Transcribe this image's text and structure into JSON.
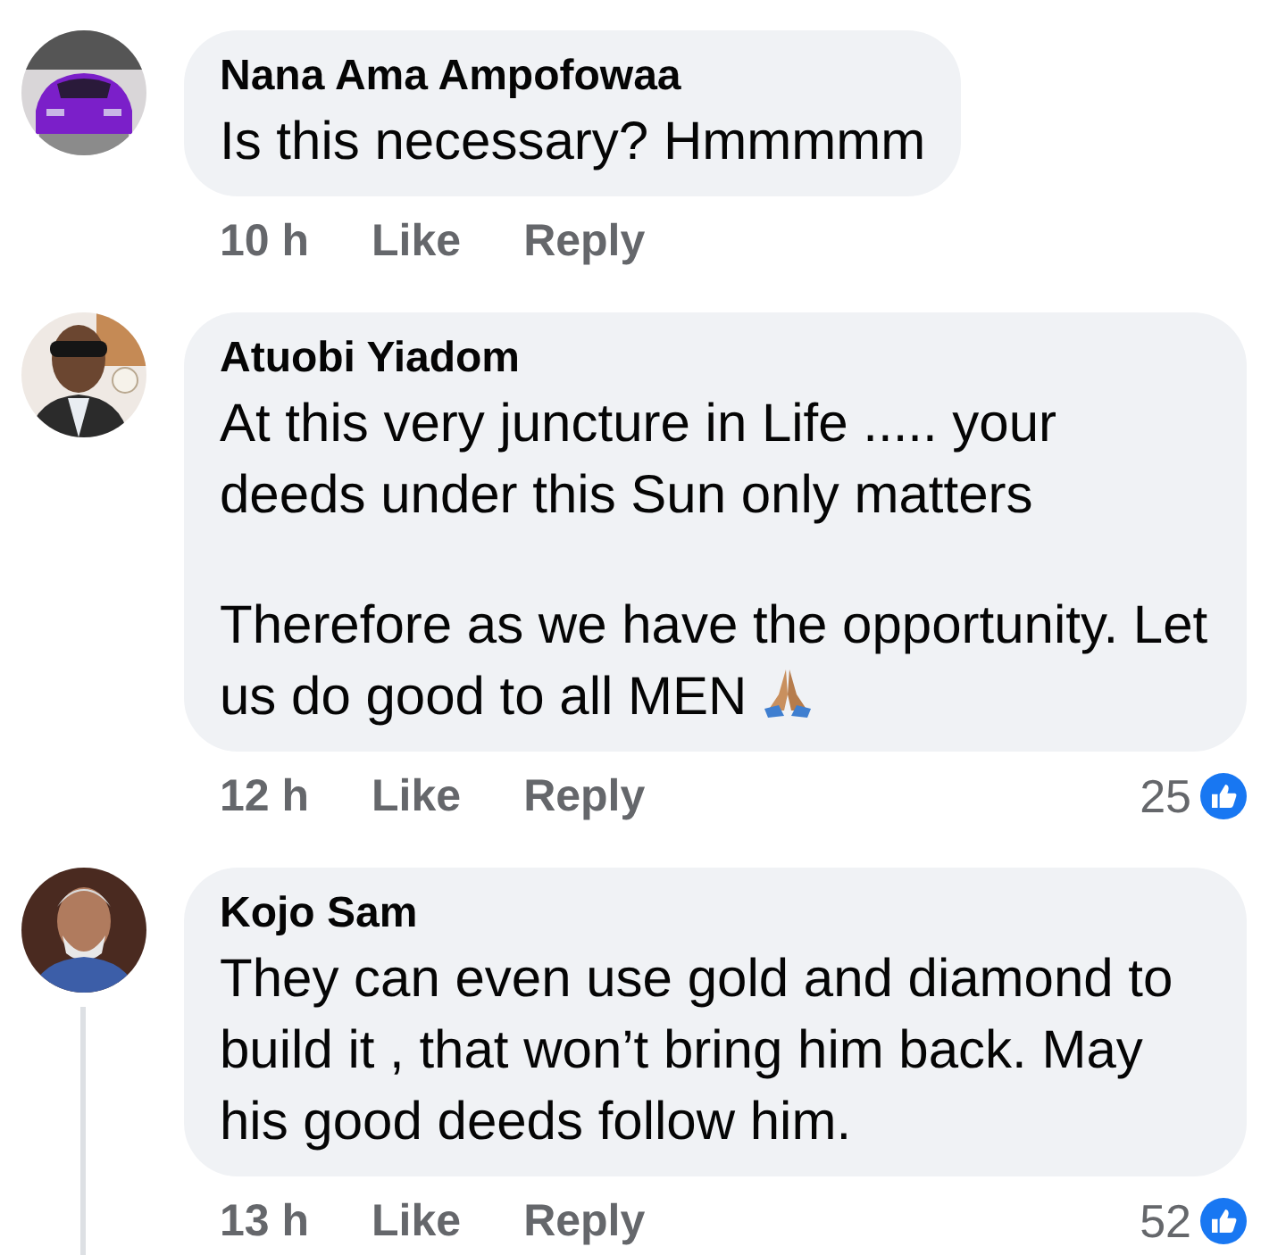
{
  "comments": [
    {
      "author": "Nana Ama Ampofowaa",
      "paragraphs": [
        "Is this necessary? Hmmmmm"
      ],
      "emoji": false,
      "time": "10 h",
      "actions": [
        "Like",
        "Reply"
      ],
      "thread_line": false
    },
    {
      "author": "Atuobi Yiadom",
      "paragraphs": [
        "At this very juncture in Life ..... your deeds under this Sun only matters",
        "Therefore as we have the opportunity. Let us do good to all MEN"
      ],
      "emoji": true,
      "time": "12 h",
      "actions": [
        "Like",
        "Reply"
      ],
      "reactions": "25",
      "thread_line": false
    },
    {
      "author": "Kojo Sam",
      "paragraphs": [
        "They can even use gold and diamond to build it , that won’t bring him back. May his good deeds follow him."
      ],
      "emoji": false,
      "time": "13 h",
      "actions": [
        "Like",
        "Reply"
      ],
      "reactions": "52",
      "thread_line": true
    }
  ]
}
